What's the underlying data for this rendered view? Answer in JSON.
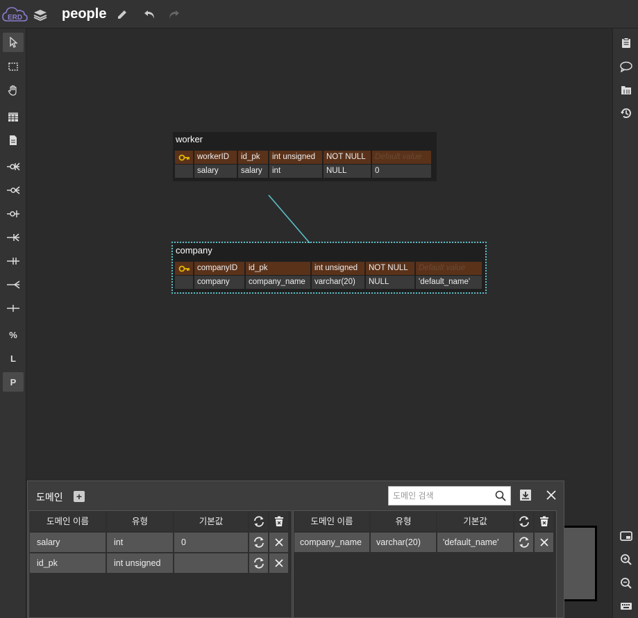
{
  "app": {
    "title": "people",
    "logo_text": "ERD"
  },
  "toolbar": {
    "left_tools": [
      {
        "icon": "pointer-icon",
        "active": true
      },
      {
        "icon": "select-rect-icon"
      },
      {
        "icon": "hand-icon"
      },
      {
        "icon": "table-icon"
      },
      {
        "icon": "memo-icon"
      },
      {
        "icon": "relation-zero-one-n-icon"
      },
      {
        "icon": "relation-zero-n-icon"
      },
      {
        "icon": "relation-zero-one-icon"
      },
      {
        "icon": "relation-one-n-icon"
      },
      {
        "icon": "relation-one-one-icon"
      },
      {
        "icon": "relation-n-icon"
      },
      {
        "icon": "relation-one-icon"
      },
      {
        "icon": "percent-icon",
        "label": "%"
      },
      {
        "icon": "l-letter-icon",
        "label": "L"
      },
      {
        "icon": "p-letter-icon",
        "label": "P"
      }
    ],
    "right_tools": [
      "clipboard-icon",
      "comment-icon",
      "sql-icon",
      "history-icon"
    ],
    "bottom_right_tools": [
      "minimap-toggle-icon",
      "zoom-in-icon",
      "zoom-out-icon",
      "keyboard-icon"
    ]
  },
  "tables": [
    {
      "name": "worker",
      "rows": [
        {
          "pk": true,
          "name": "workerID",
          "domain": "id_pk",
          "type": "int unsigned",
          "nullable": "NOT NULL",
          "default": "Default value",
          "default_placeholder": true
        },
        {
          "pk": false,
          "name": "salary",
          "domain": "salary",
          "type": "int",
          "nullable": "NULL",
          "default": "0",
          "default_placeholder": false
        }
      ]
    },
    {
      "name": "company",
      "rows": [
        {
          "pk": true,
          "name": "companyID",
          "domain": "id_pk",
          "type": "int unsigned",
          "nullable": "NOT NULL",
          "default": "Default value",
          "default_placeholder": true
        },
        {
          "pk": false,
          "name": "company",
          "domain": "company_name",
          "type": "varchar(20)",
          "nullable": "NULL",
          "default": "'default_name'",
          "default_placeholder": false
        }
      ]
    }
  ],
  "domain_panel": {
    "title": "도메인",
    "search_placeholder": "도메인 검색",
    "headers": {
      "name": "도메인 이름",
      "type": "유형",
      "default": "기본값"
    },
    "left_rows": [
      {
        "name": "salary",
        "type": "int",
        "default": "0"
      },
      {
        "name": "id_pk",
        "type": "int unsigned",
        "default": ""
      }
    ],
    "right_rows": [
      {
        "name": "company_name",
        "type": "varchar(20)",
        "default": "'default_name'"
      }
    ]
  },
  "colors": {
    "accent_line": "#5bc0c7",
    "pk_row": "#5a321a",
    "key_icon": "#e6b800"
  }
}
